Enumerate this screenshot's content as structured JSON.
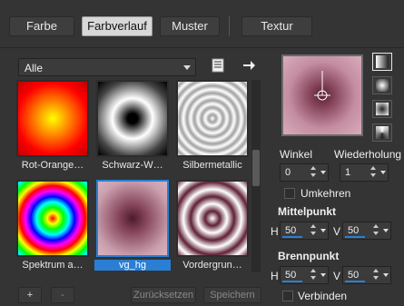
{
  "tabs": [
    {
      "label": "Farbe",
      "active": false
    },
    {
      "label": "Farbverlauf",
      "active": true
    },
    {
      "label": "Muster",
      "active": false
    },
    {
      "label": "Textur",
      "active": false
    }
  ],
  "category_dropdown": {
    "selected": "Alle"
  },
  "icons": {
    "list_icon": "library-list-icon",
    "arrow_icon": "arrow-right-icon"
  },
  "gradients": [
    {
      "label": "Rot-Orange…",
      "colors": [
        "#ff0000",
        "#ff8000",
        "#ffff00"
      ]
    },
    {
      "label": "Schwarz-W…",
      "colors": [
        "#ffffff",
        "#000000"
      ]
    },
    {
      "label": "Silbermetallic",
      "colors": [
        "#ffffff",
        "#808080"
      ]
    },
    {
      "label": "Spektrum a…",
      "colors": [
        "#ff0000",
        "#ffff00",
        "#00ff00",
        "#00ffff",
        "#0000ff",
        "#ff00ff"
      ]
    },
    {
      "label": "vg_hg",
      "colors": [
        "#caa0ae",
        "#5e2035"
      ],
      "selected": true
    },
    {
      "label": "Vordergrun…",
      "colors": [
        "#ffffff",
        "#5e2035"
      ]
    }
  ],
  "bottom_buttons": {
    "add": "+",
    "remove": "-",
    "reset": "Zurücksetzen",
    "save": "Speichern"
  },
  "preview_colors": {
    "outer": "#d29cb0",
    "inner": "#5a1e34"
  },
  "angle": {
    "label": "Winkel",
    "value": "0"
  },
  "repeat": {
    "label": "Wiederholung",
    "value": "1"
  },
  "invert": {
    "label": "Umkehren",
    "checked": false
  },
  "center": {
    "label": "Mittelpunkt",
    "h_label": "H",
    "v_label": "V",
    "h": "50",
    "v": "50",
    "h_fraction": 0.5,
    "v_fraction": 0.5
  },
  "focus": {
    "label": "Brennpunkt",
    "h_label": "H",
    "v_label": "V",
    "h": "50",
    "v": "50",
    "h_fraction": 0.5,
    "v_fraction": 0.5
  },
  "link": {
    "label": "Verbinden",
    "checked": false
  },
  "accent_color": "#2a7fd4"
}
